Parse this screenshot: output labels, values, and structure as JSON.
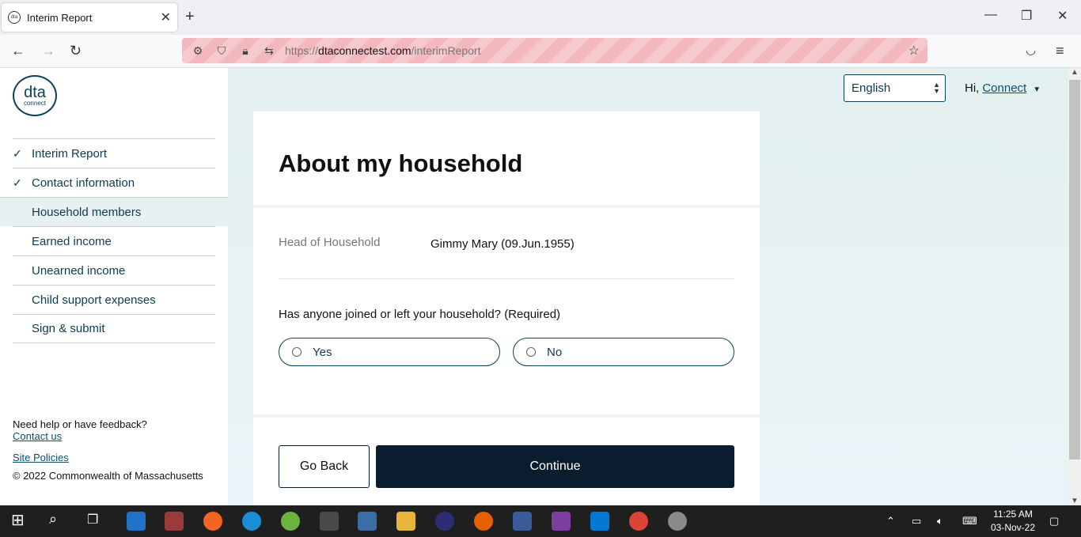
{
  "browser": {
    "tab_title": "Interim Report",
    "url_prefix": "https://",
    "url_domain": "dtaconnectest.com",
    "url_path": "/interimReport"
  },
  "logo": {
    "main": "dta",
    "sub": "connect"
  },
  "sidebar": {
    "items": [
      {
        "label": "Interim Report",
        "done": true
      },
      {
        "label": "Contact information",
        "done": true
      },
      {
        "label": "Household members",
        "done": false,
        "active": true
      },
      {
        "label": "Earned income",
        "done": false
      },
      {
        "label": "Unearned income",
        "done": false
      },
      {
        "label": "Child support expenses",
        "done": false
      },
      {
        "label": "Sign & submit",
        "done": false
      }
    ],
    "help_text": "Need help or have feedback?",
    "contact_link": "Contact us",
    "policies_link": "Site Policies",
    "copyright": "© 2022 Commonwealth of Massachusetts"
  },
  "header": {
    "language": "English",
    "greeting": "Hi,",
    "user": "Connect"
  },
  "main": {
    "title": "About my household",
    "hoh_label": "Head of Household",
    "hoh_value": "Gimmy Mary (09.Jun.1955)",
    "question": "Has anyone joined or left your household? (Required)",
    "option_yes": "Yes",
    "option_no": "No",
    "back_label": "Go Back",
    "continue_label": "Continue"
  },
  "taskbar": {
    "time": "11:25 AM",
    "date": "03-Nov-22"
  },
  "colors": {
    "primary": "#0a1d2e",
    "link": "#0d4f6e",
    "url_stripe": "#f2b8bd"
  }
}
